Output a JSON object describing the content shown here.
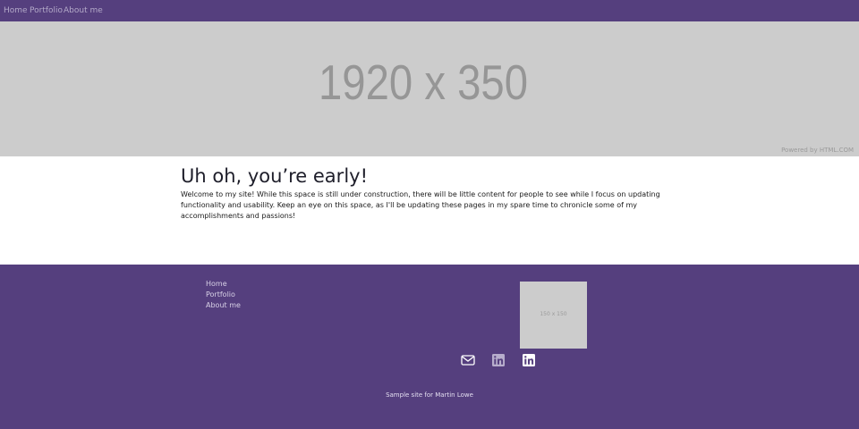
{
  "nav": {
    "items": [
      "Home",
      "Portfolio",
      "About me"
    ]
  },
  "hero": {
    "image_label": "1920 x 350",
    "credit": "Powered by HTML.COM"
  },
  "content": {
    "title": "Uh oh, you’re early!",
    "body": "Welcome to my site! While this space is still under construction, there will be little content for people to see while I focus on updating functionality and usability. Keep an eye on this space, as I'll be updating these pages in my spare time to chronicle some of my accomplishments and passions!"
  },
  "footer": {
    "links": [
      "Home",
      "Portfolio",
      "About me"
    ],
    "image_label": "150 x 150",
    "social_icons": [
      "mail-icon",
      "linkedin-icon",
      "linkedin-icon"
    ],
    "credit": "Sample site for Martin Lowe"
  },
  "colors": {
    "brand_purple": "#553f7e",
    "placeholder_gray": "#cccccc"
  }
}
